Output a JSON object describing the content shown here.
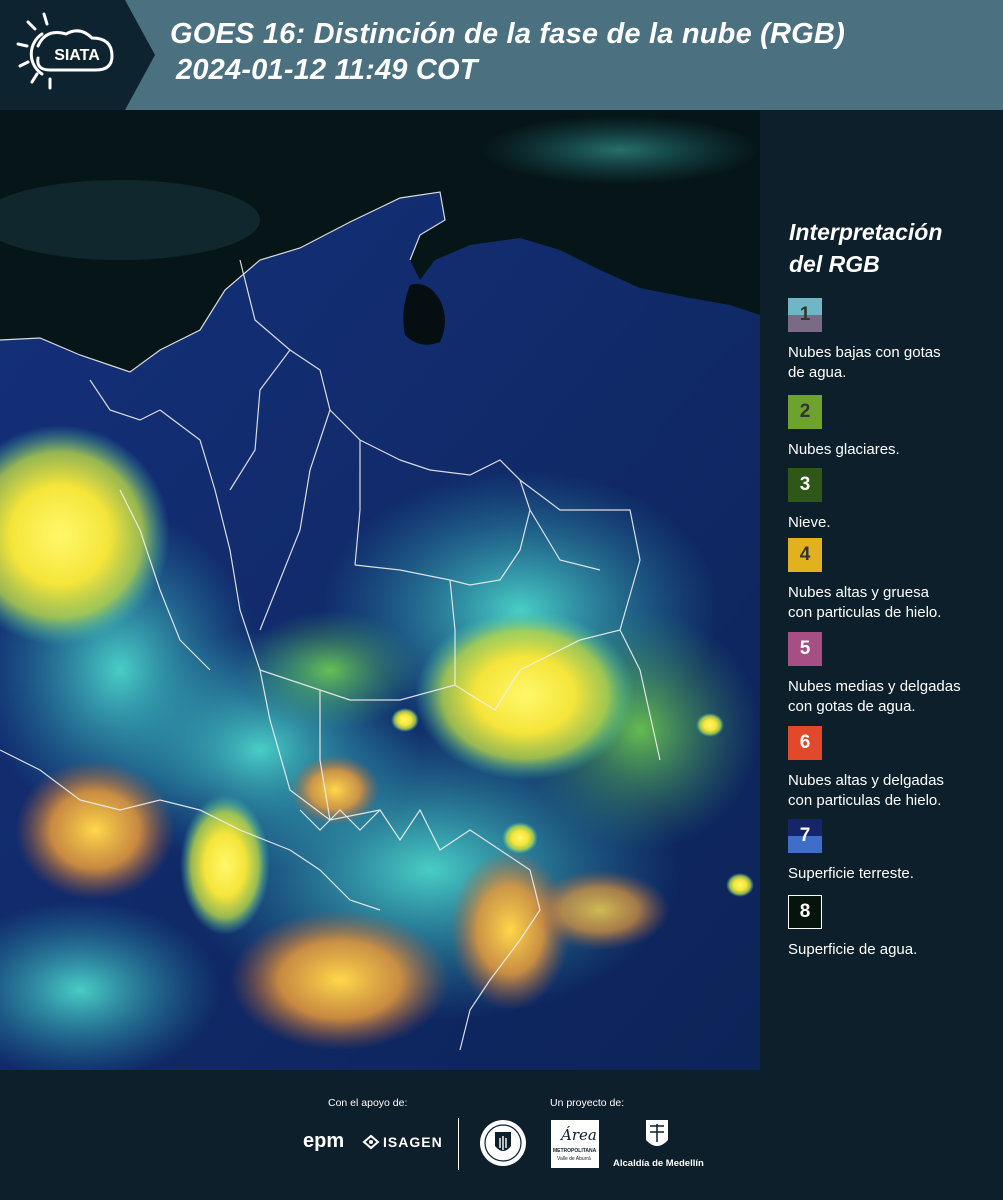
{
  "header": {
    "logo_text": "SIATA",
    "title_line1": "GOES 16: Distinción de la fase de la nube (RGB)",
    "title_line2": "2024-01-12 11:49 COT"
  },
  "legend": {
    "title_line1": "Interpretación",
    "title_line2": "del RGB",
    "items": [
      {
        "num": "1",
        "label_line1": "Nubes bajas con gotas",
        "label_line2": "de agua.",
        "color_top": "#6fb7c4",
        "color_bottom": "#7a6a86"
      },
      {
        "num": "2",
        "label_line1": "Nubes glaciares.",
        "label_line2": "",
        "color_top": "#6da32d",
        "color_bottom": "#6da32d"
      },
      {
        "num": "3",
        "label_line1": "Nieve.",
        "label_line2": "",
        "color_top": "#2e5718",
        "color_bottom": "#2e5718"
      },
      {
        "num": "4",
        "label_line1": "Nubes altas y gruesa",
        "label_line2": "con particulas de hielo.",
        "color_top": "#e2b21e",
        "color_bottom": "#e2b21e"
      },
      {
        "num": "5",
        "label_line1": "Nubes medias y delgadas",
        "label_line2": "con gotas de agua.",
        "color_top": "#a64f84",
        "color_bottom": "#a64f84"
      },
      {
        "num": "6",
        "label_line1": "Nubes altas y delgadas",
        "label_line2": "con particulas de hielo.",
        "color_top": "#e2482a",
        "color_bottom": "#e2482a"
      },
      {
        "num": "7",
        "label_line1": "Superficie terreste.",
        "label_line2": "",
        "color_top": "#16246a",
        "color_bottom": "#3e6ec8"
      },
      {
        "num": "8",
        "label_line1": "Superficie de agua.",
        "label_line2": "",
        "color_top": "#06140e",
        "color_bottom": "#06140e"
      }
    ]
  },
  "footer": {
    "support_label": "Con el apoyo de:",
    "project_label": "Un proyecto de:",
    "sponsor1": "epm",
    "sponsor2": "ISAGEN",
    "partner_area_line1": "Área",
    "partner_area_line2": "METROPOLITANA",
    "partner_area_line3": "Valle de Aburrá",
    "partner_alcaldia": "Alcaldía de Medellín"
  },
  "map": {
    "description_colors": {
      "land": "#102a6a",
      "ocean": "#061416",
      "high_cloud": "#f2e23a",
      "low_cloud": "#3fd0c8"
    }
  }
}
